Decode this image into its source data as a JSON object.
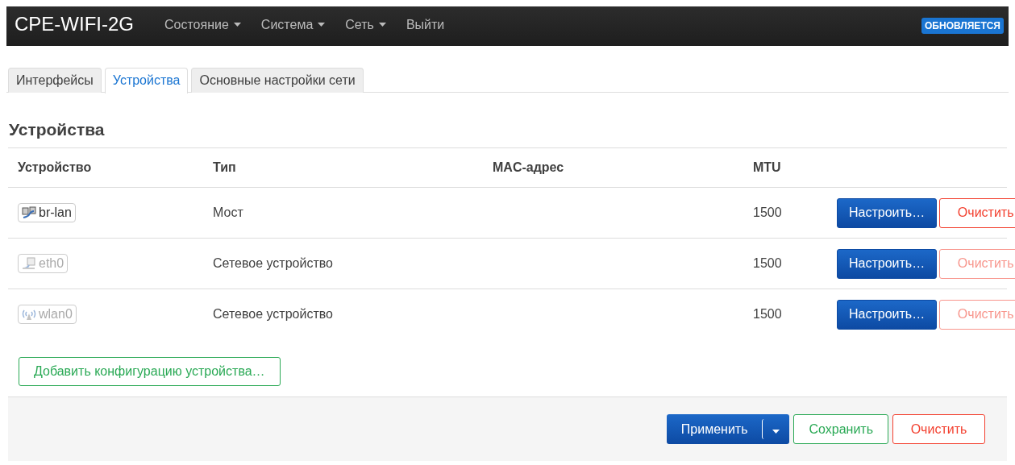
{
  "header": {
    "brand": "CPE-WIFI-2G",
    "menu": [
      {
        "label": "Состояние",
        "dropdown": true
      },
      {
        "label": "Система",
        "dropdown": true
      },
      {
        "label": "Сеть",
        "dropdown": true
      },
      {
        "label": "Выйти",
        "dropdown": false
      }
    ],
    "badge": "ОБНОВЛЯЕТСЯ"
  },
  "tabs": [
    {
      "label": "Интерфейсы",
      "selected": false
    },
    {
      "label": "Устройства",
      "selected": true
    },
    {
      "label": "Основные настройки сети",
      "selected": false
    }
  ],
  "section_title": "Устройства",
  "table": {
    "columns": [
      "Устройство",
      "Тип",
      "MAC-адрес",
      "MTU"
    ],
    "rows": [
      {
        "device": "br-lan",
        "kind": "bridge",
        "disabled": false,
        "type": "Мост",
        "mtu": "1500",
        "configure": "Настроить…",
        "clear": "Очистить"
      },
      {
        "device": "eth0",
        "kind": "ethernet",
        "disabled": true,
        "type": "Сетевое устройство",
        "mtu": "1500",
        "configure": "Настроить…",
        "clear": "Очистить"
      },
      {
        "device": "wlan0",
        "kind": "wireless",
        "disabled": true,
        "type": "Сетевое устройство",
        "mtu": "1500",
        "configure": "Настроить…",
        "clear": "Очистить"
      }
    ]
  },
  "add_button": "Добавить конфигурацию устройства…",
  "footer": {
    "apply": "Применить",
    "save": "Сохранить",
    "reset": "Очистить"
  }
}
